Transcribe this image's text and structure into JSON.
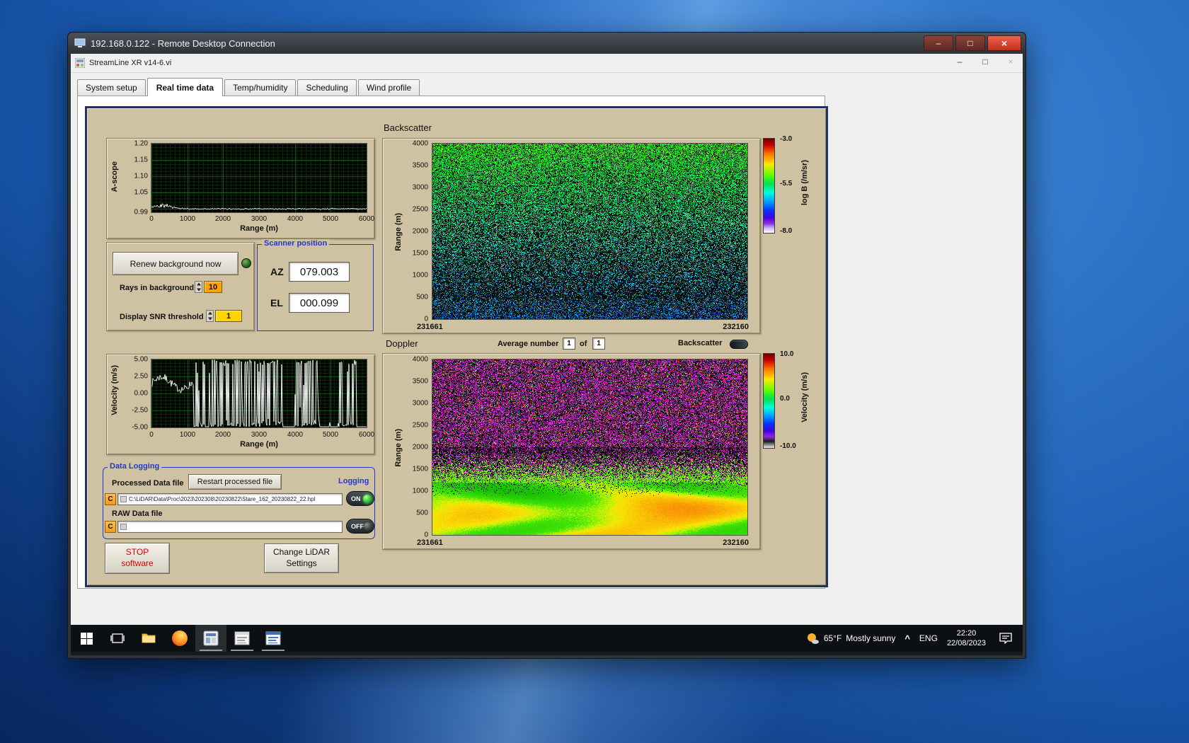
{
  "rdp": {
    "title": "192.168.0.122 - Remote Desktop Connection",
    "controls": {
      "minimize": "–",
      "maximize": "□",
      "close": "×"
    }
  },
  "app": {
    "title": "StreamLine XR v14-6.vi",
    "controls": {
      "minimize": "–",
      "maximize": "□",
      "close": "×"
    },
    "tabs": [
      {
        "label": "System setup"
      },
      {
        "label": "Real time data"
      },
      {
        "label": "Temp/humidity"
      },
      {
        "label": "Scheduling"
      },
      {
        "label": "Wind profile"
      }
    ]
  },
  "ascope": {
    "ylabel": "A-scope",
    "xlabel": "Range (m)",
    "yticks": [
      "1.20",
      "1.15",
      "1.10",
      "1.05",
      "0.99"
    ],
    "xticks": [
      "0",
      "1000",
      "2000",
      "3000",
      "4000",
      "5000",
      "6000"
    ]
  },
  "controls": {
    "renew_button": "Renew background now",
    "rays_label": "Rays in background",
    "rays_value": "10",
    "snr_label": "Display SNR threshold",
    "snr_value": "1"
  },
  "scanner": {
    "title": "Scanner position",
    "az_label": "AZ",
    "az_value": "079.003",
    "el_label": "EL",
    "el_value": "000.099"
  },
  "backscatter": {
    "title": "Backscatter",
    "ylabel": "Range (m)",
    "yticks": [
      "4000",
      "3500",
      "3000",
      "2500",
      "2000",
      "1500",
      "1000",
      "500",
      "0"
    ],
    "x_start": "231661",
    "x_end": "232160",
    "colorbar_ticks": [
      "-3.0",
      "-5.5",
      "-8.0"
    ],
    "colorbar_label": "log B (/m/sr)"
  },
  "doppler": {
    "title": "Doppler",
    "avg_label": "Average number",
    "avg_value": "1",
    "of_label": "of",
    "of_value": "1",
    "toggle_label": "Backscatter",
    "ylabel": "Range (m)",
    "yticks": [
      "4000",
      "3500",
      "3000",
      "2500",
      "2000",
      "1500",
      "1000",
      "500",
      "0"
    ],
    "x_start": "231661",
    "x_end": "232160",
    "colorbar_ticks": [
      "10.0",
      "0.0",
      "-10.0"
    ],
    "colorbar_label": "Velocity (m/s)"
  },
  "velocity": {
    "ylabel": "Velocity (m/s)",
    "xlabel": "Range (m)",
    "yticks": [
      "5.00",
      "2.50",
      "0.00",
      "-2.50",
      "-5.00"
    ],
    "xticks": [
      "0",
      "1000",
      "2000",
      "3000",
      "4000",
      "5000",
      "6000"
    ]
  },
  "logging": {
    "title": "Data Logging",
    "processed_label": "Processed Data file",
    "restart_button": "Restart processed file",
    "logging_label": "Logging",
    "drive": "C",
    "processed_path": "C:\\LiDAR\\Data\\Proc\\2023\\202308\\20230822\\Stare_162_20230822_22.hpl",
    "raw_label": "RAW Data file",
    "raw_path": "",
    "on_label": "ON",
    "off_label": "OFF"
  },
  "actions": {
    "stop_line1": "STOP",
    "stop_line2": "software",
    "change_line1": "Change LiDAR",
    "change_line2": "Settings"
  },
  "taskbar": {
    "weather_temp": "65°F",
    "weather_desc": "Mostly sunny",
    "chevron": "^",
    "lang": "ENG",
    "time": "22:20",
    "date": "22/08/2023"
  },
  "colors": {
    "panel_tan": "#cfc2a2",
    "group_blue": "#2638c8",
    "value_orange": "#ffa200",
    "value_yellow": "#ffd400",
    "led_green": "#37c437",
    "stop_red": "#d40000"
  }
}
